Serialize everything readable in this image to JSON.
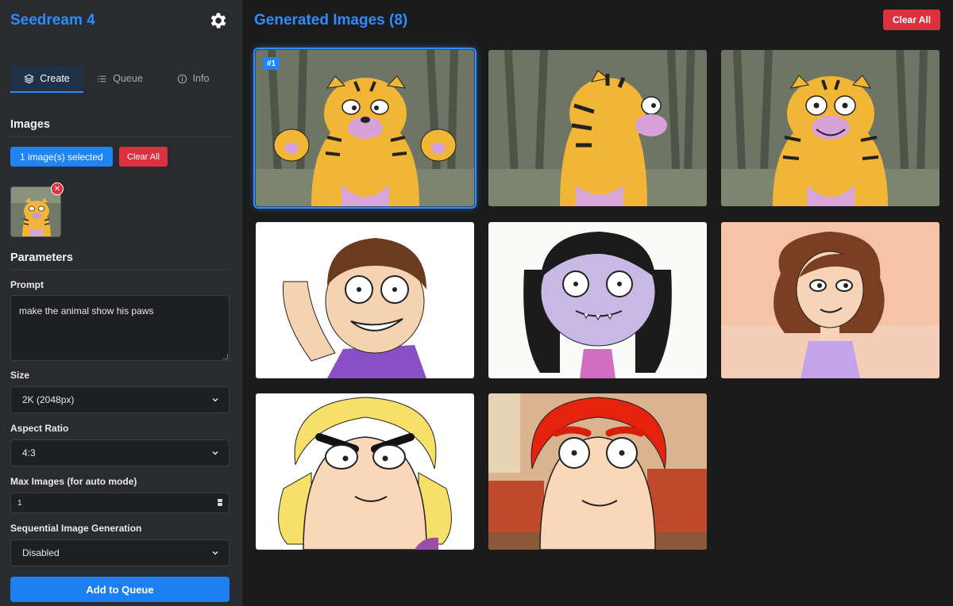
{
  "sidebar": {
    "app_title": "Seedream 4",
    "tabs": [
      {
        "label": "Create",
        "icon": "layers-icon",
        "active": true
      },
      {
        "label": "Queue",
        "icon": "list-icon",
        "active": false
      },
      {
        "label": "Info",
        "icon": "info-icon",
        "active": false
      }
    ],
    "images_section": {
      "title": "Images",
      "selected_label": "1 image(s) selected",
      "clear_label": "Clear All"
    },
    "parameters": {
      "title": "Parameters",
      "prompt_label": "Prompt",
      "prompt_value": "make the animal show his paws",
      "size_label": "Size",
      "size_value": "2K (2048px)",
      "aspect_label": "Aspect Ratio",
      "aspect_value": "4:3",
      "max_images_label": "Max Images (for auto mode)",
      "max_images_value": "1",
      "sequential_label": "Sequential Image Generation",
      "sequential_value": "Disabled"
    },
    "add_button": "Add to Queue"
  },
  "main": {
    "title": "Generated Images (8)",
    "clear_label": "Clear All",
    "selected_badge": "#1",
    "images": [
      {
        "subject": "tiger-paws-up"
      },
      {
        "subject": "tiger-profile"
      },
      {
        "subject": "tiger-smiling"
      },
      {
        "subject": "boy-waving"
      },
      {
        "subject": "girl-pigtails"
      },
      {
        "subject": "woman-wavy-hair"
      },
      {
        "subject": "blond-man-frowning"
      },
      {
        "subject": "redhead-man-living-room"
      }
    ]
  },
  "colors": {
    "accent": "#2f8cff",
    "danger": "#dc3240",
    "sidebar_bg": "#2a2b2e",
    "main_bg": "#1b1b1c"
  }
}
